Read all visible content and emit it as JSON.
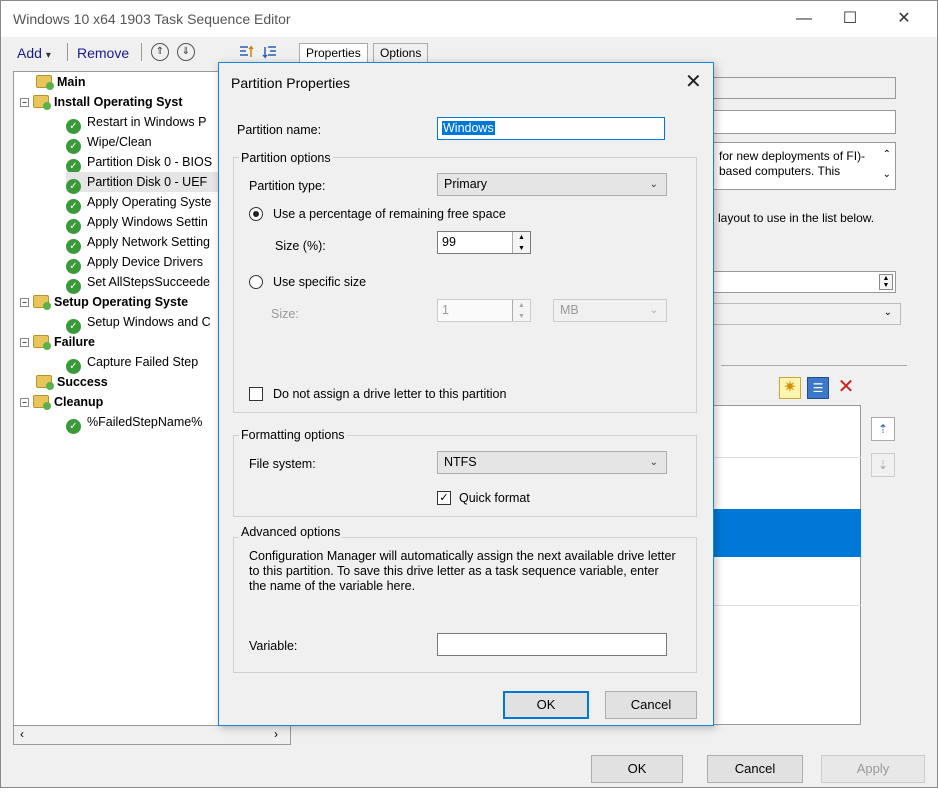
{
  "window": {
    "title": "Windows 10 x64 1903 Task Sequence Editor",
    "controls": {
      "minimize": "—",
      "maximize": "☐",
      "close": "✕"
    }
  },
  "toolbar": {
    "add_label": "Add",
    "add_arrow": "▾",
    "remove_label": "Remove",
    "move_up_glyph": "⇑",
    "move_down_glyph": "⇓"
  },
  "tabs": [
    {
      "label": "Properties"
    },
    {
      "label": "Options"
    }
  ],
  "tree": {
    "items": [
      {
        "label": "Main"
      },
      {
        "label": "Install Operating Syst"
      },
      {
        "label": "Restart in Windows P"
      },
      {
        "label": "Wipe/Clean"
      },
      {
        "label": "Partition Disk 0 - BIOS"
      },
      {
        "label": "Partition Disk 0 - UEF"
      },
      {
        "label": "Apply Operating Syste"
      },
      {
        "label": "Apply Windows Settin"
      },
      {
        "label": "Apply Network Setting"
      },
      {
        "label": "Apply Device Drivers"
      },
      {
        "label": "Set AllStepsSucceede"
      },
      {
        "label": "Setup Operating Syste"
      },
      {
        "label": "Setup Windows and C"
      },
      {
        "label": "Failure"
      },
      {
        "label": "Capture Failed Step"
      },
      {
        "label": "Success"
      },
      {
        "label": "Cleanup"
      },
      {
        "label": "%FailedStepName%"
      }
    ]
  },
  "right_panel": {
    "description": "for new deployments of FI)-based computers. This",
    "layout_text": "layout to use in the list below."
  },
  "footer": {
    "ok_label": "OK",
    "cancel_label": "Cancel",
    "apply_label": "Apply"
  },
  "dialog": {
    "title": "Partition Properties",
    "partition_name_label": "Partition name:",
    "partition_name_value": "Windows",
    "partition_options_title": "Partition options",
    "partition_type_label": "Partition type:",
    "partition_type_value": "Primary",
    "use_percentage_label": "Use a percentage of remaining free space",
    "size_percent_label": "Size (%):",
    "size_percent_value": "99",
    "use_specific_label": "Use specific size",
    "size_label": "Size:",
    "size_value": "1",
    "size_unit": "MB",
    "no_drive_letter_label": "Do not assign a drive letter to this partition",
    "formatting_title": "Formatting options",
    "file_system_label": "File system:",
    "file_system_value": "NTFS",
    "quick_format_label": "Quick format",
    "advanced_title": "Advanced options",
    "advanced_text": "Configuration Manager will automatically assign the next available drive letter to this partition. To save this drive letter as a task sequence variable, enter the name of the variable here.",
    "variable_label": "Variable:",
    "variable_value": "",
    "ok_label": "OK",
    "cancel_label": "Cancel"
  }
}
